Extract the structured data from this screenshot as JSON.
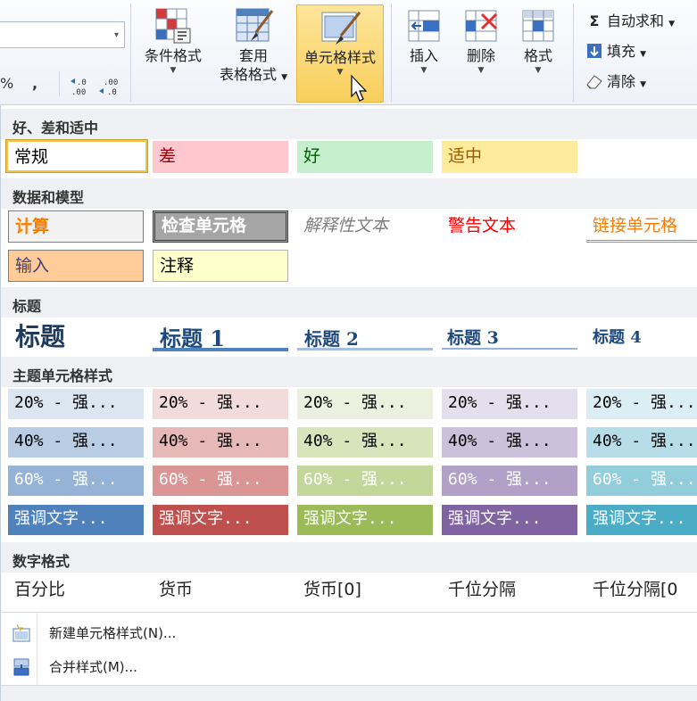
{
  "ribbon": {
    "number_symbols": [
      "%",
      ",",
      "←.0 .00",
      "→.00 .0"
    ],
    "buttons": [
      {
        "id": "conditional",
        "label1": "条件格式",
        "label2": "",
        "icon": "conditional-format-icon"
      },
      {
        "id": "table",
        "label1": "套用",
        "label2": "表格格式",
        "icon": "format-as-table-icon"
      },
      {
        "id": "cellstyle",
        "label1": "单元格样式",
        "label2": "",
        "icon": "cell-styles-icon",
        "active": true
      },
      {
        "id": "insert",
        "label1": "插入",
        "label2": "",
        "icon": "insert-cells-icon"
      },
      {
        "id": "delete",
        "label1": "删除",
        "label2": "",
        "icon": "delete-cells-icon"
      },
      {
        "id": "format",
        "label1": "格式",
        "label2": "",
        "icon": "format-cells-icon"
      }
    ],
    "editing": {
      "autosum": "自动求和",
      "fill": "填充",
      "clear": "清除"
    }
  },
  "gallery": {
    "sections": [
      "好、差和适中",
      "数据和模型",
      "标题",
      "主题单元格样式",
      "数字格式"
    ],
    "good_bad_neutral": [
      {
        "label": "常规",
        "bg": "#ffffff",
        "fg": "#000000"
      },
      {
        "label": "差",
        "bg": "#ffc7ce",
        "fg": "#9c0006"
      },
      {
        "label": "好",
        "bg": "#c6efce",
        "fg": "#006100"
      },
      {
        "label": "适中",
        "bg": "#ffeb9c",
        "fg": "#9c5700"
      }
    ],
    "data_model": [
      {
        "label": "计算",
        "bg": "#f2f2f2",
        "fg": "#fa7d00"
      },
      {
        "label": "检查单元格",
        "bg": "#a5a5a5",
        "fg": "#ffffff"
      },
      {
        "label": "解释性文本",
        "bg": "#ffffff",
        "fg": "#7f7f7f"
      },
      {
        "label": "警告文本",
        "bg": "#ffffff",
        "fg": "#ff0000"
      },
      {
        "label": "链接单元格",
        "bg": "#ffffff",
        "fg": "#fa7d00"
      },
      {
        "label": "输入",
        "bg": "#ffcc99",
        "fg": "#3f3f76"
      },
      {
        "label": "注释",
        "bg": "#ffffcc",
        "fg": "#000000"
      }
    ],
    "headings": [
      "标题",
      "标题 1",
      "标题 2",
      "标题 3",
      "标题 4"
    ],
    "theme_rows": [
      {
        "label": "20% - 强...",
        "colors": [
          "#dce6f1",
          "#f2dcdb",
          "#ebf1de",
          "#e4dfec",
          "#daeef3"
        ],
        "fg": "#000000"
      },
      {
        "label": "40% - 强...",
        "colors": [
          "#b8cce4",
          "#e6b8b7",
          "#d8e4bc",
          "#ccc0da",
          "#b7dee8"
        ],
        "fg": "#000000"
      },
      {
        "label": "60% - 强...",
        "colors": [
          "#95b3d7",
          "#da9694",
          "#c4d79b",
          "#b1a0c7",
          "#92cddc"
        ],
        "fg": "#ffffff"
      },
      {
        "label": "强调文字...",
        "colors": [
          "#4f81bd",
          "#c0504d",
          "#9bbb59",
          "#8064a2",
          "#4bacc6"
        ],
        "fg": "#ffffff"
      }
    ],
    "number_formats": [
      "百分比",
      "货币",
      "货币[0]",
      "千位分隔",
      "千位分隔[0"
    ]
  },
  "menu": {
    "new_style": "新建单元格样式(N)...",
    "merge_styles": "合并样式(M)..."
  }
}
